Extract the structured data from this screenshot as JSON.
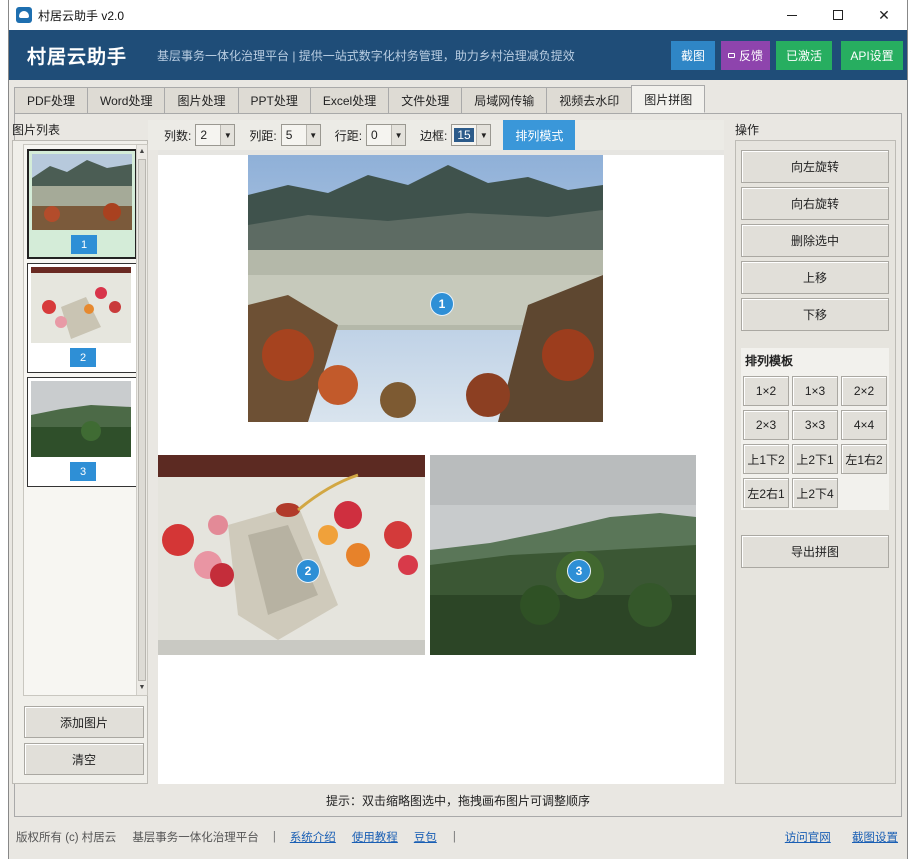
{
  "window": {
    "title": "村居云助手 v2.0"
  },
  "header": {
    "brand": "村居云助手",
    "slogan": "基层事务一体化治理平台 | 提供一站式数字化村务管理，助力乡村治理减负提效",
    "buttons": {
      "screenshot": "截图",
      "feedback": "反馈",
      "activated": "已激活",
      "api": "API设置"
    },
    "colors": {
      "band": "#1f4d78",
      "screenshot": "#2f86c6",
      "feedback": "#8e44ad",
      "activated": "#27ae60",
      "api": "#27ae60"
    }
  },
  "tabs": [
    "PDF处理",
    "Word处理",
    "图片处理",
    "PPT处理",
    "Excel处理",
    "文件处理",
    "局域网传输",
    "视频去水印",
    "图片拼图"
  ],
  "active_tab": "图片拼图",
  "left": {
    "label": "图片列表",
    "thumbnails": [
      {
        "num": "1",
        "scene": "mountain-frost"
      },
      {
        "num": "2",
        "scene": "peony-painting"
      },
      {
        "num": "3",
        "scene": "green-hills"
      }
    ],
    "add_button": "添加图片",
    "clear_button": "清空"
  },
  "toolbar": {
    "cols_label": "列数:",
    "cols_value": "2",
    "col_gap_label": "列距:",
    "col_gap_value": "5",
    "row_gap_label": "行距:",
    "row_gap_value": "0",
    "border_label": "边框:",
    "border_value": "15",
    "mode_button": "排列模式"
  },
  "canvas": {
    "badges": [
      "1",
      "2",
      "3"
    ]
  },
  "right": {
    "label": "操作",
    "ops": [
      "向左旋转",
      "向右旋转",
      "删除选中",
      "上移",
      "下移"
    ],
    "template_title": "排列模板",
    "templates": [
      "1×2",
      "1×3",
      "2×2",
      "2×3",
      "3×3",
      "4×4",
      "上1下2",
      "上2下1",
      "左1右2",
      "左2右1",
      "上2下4"
    ],
    "export_button": "导出拼图"
  },
  "hint": "提示：双击缩略图选中，拖拽画布图片可调整顺序",
  "footer": {
    "copyright": "版权所有 (c) 村居云",
    "platform": "基层事务一体化治理平台",
    "links": [
      "系统介绍",
      "使用教程",
      "豆包"
    ],
    "right_links": [
      "访问官网",
      "截图设置"
    ]
  }
}
